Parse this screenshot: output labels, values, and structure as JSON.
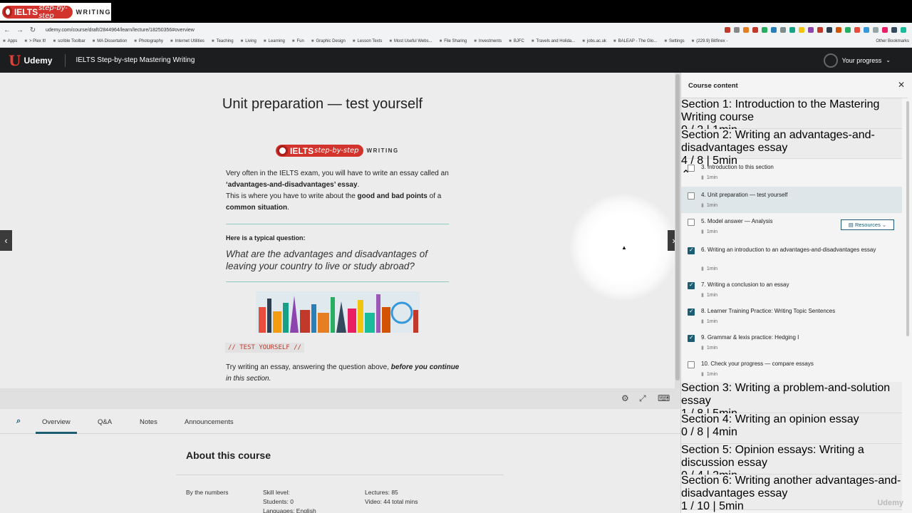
{
  "overlay_logo": {
    "brand": "IELTS",
    "stepby": "step-by-step",
    "writing": "WRITING"
  },
  "browser": {
    "back": "←",
    "forward": "→",
    "reload": "↻",
    "url": "udemy.com/course/draft/2844964/learn/lecture/18250356#overview",
    "bookmarks": [
      "Apps",
      "> Plex It!",
      "scrible Toolbar",
      "MA Dissertation",
      "Photography",
      "Internet Utilities",
      "Teaching",
      "Living",
      "Learning",
      "Fun",
      "Graphic Design",
      "Lesson Texts",
      "Most Useful Webs...",
      "File Sharing",
      "Investments",
      "BJFC",
      "Travels and Holida...",
      "jobs.ac.uk",
      "BALEAP - The Glo...",
      "Settings",
      "(229.9) Bitfinex -"
    ],
    "other_bookmarks": "Other Bookmarks",
    "ext_colors": [
      "#c0392b",
      "#888888",
      "#e67e22",
      "#c0392b",
      "#27ae60",
      "#2980b9",
      "#7f8c8d",
      "#16a085",
      "#f1c40f",
      "#8e44ad",
      "#c0392b",
      "#2c3e50",
      "#d35400",
      "#27ae60",
      "#e74c3c",
      "#3498db",
      "#95a5a6",
      "#e91e63",
      "#34495e",
      "#1abc9c"
    ]
  },
  "header": {
    "logo": "Udemy",
    "course_title": "IELTS Step-by-step Mastering Writing",
    "progress_label": "Your progress"
  },
  "slide": {
    "title": "Unit preparation — test yourself",
    "logo_brand": "IELTS",
    "logo_stepby": "step-by-step",
    "logo_writing": "WRITING",
    "para1_a": "Very often in the IELTS exam, you will have to write an essay called an ",
    "para1_b": "‘advantages-and-disadvantages’ essay",
    "para1_c": ".",
    "para1_d": "This is where you have to write about the ",
    "para1_e": "good and bad points",
    "para1_f": " of a ",
    "para1_g": "common situation",
    "para1_h": ".",
    "question_label": "Here is a typical question:",
    "question": "What are the advantages and disadvantages of leaving your country to live or study abroad?",
    "test_tag": "// TEST YOURSELF //",
    "para2_a": "Try writing an essay, answering the question above, ",
    "para2_b": "before you continue",
    "para2_c": " in this section."
  },
  "tabs": {
    "overview": "Overview",
    "qa": "Q&A",
    "notes": "Notes",
    "announcements": "Announcements"
  },
  "about": {
    "heading": "About this course",
    "by_numbers": "By the numbers",
    "skill_level": "Skill level:",
    "students": "Students: 0",
    "languages": "Languages: English",
    "lectures": "Lectures: 85",
    "video": "Video: 44 total mins"
  },
  "sidebar": {
    "title": "Course content",
    "close": "✕",
    "sections": [
      {
        "title": "Section 1: Introduction to the Mastering Writing course",
        "meta": "0 / 2 | 1min",
        "expanded": false
      },
      {
        "title": "Section 2: Writing an advantages-and-disadvantages essay",
        "meta": "4 / 8 | 5min",
        "expanded": true
      },
      {
        "title": "Section 3: Writing a problem-and-solution essay",
        "meta": "1 / 8 | 5min",
        "expanded": false
      },
      {
        "title": "Section 4: Writing an opinion essay",
        "meta": "0 / 8 | 4min",
        "expanded": false
      },
      {
        "title": "Section 5: Opinion essays: Writing a discussion essay",
        "meta": "0 / 4 | 2min",
        "expanded": false
      },
      {
        "title": "Section 6: Writing another advantages-and-disadvantages essay",
        "meta": "1 / 10 | 5min",
        "expanded": false
      }
    ],
    "items": [
      {
        "title": "3. Introduction to this section",
        "duration": "1min",
        "checked": false
      },
      {
        "title": "4. Unit preparation — test yourself",
        "duration": "1min",
        "checked": false,
        "current": true
      },
      {
        "title": "5. Model answer — Analysis",
        "duration": "1min",
        "checked": false
      },
      {
        "title": "6. Writing an introduction to an advantages-and-disadvantages essay",
        "duration": "1min",
        "checked": true
      },
      {
        "title": "7. Writing a conclusion to an essay",
        "duration": "1min",
        "checked": true
      },
      {
        "title": "8. Learner Training Practice: Writing Topic Sentences",
        "duration": "1min",
        "checked": true
      },
      {
        "title": "9. Grammar & lexis practice: Hedging I",
        "duration": "1min",
        "checked": true
      },
      {
        "title": "10. Check your progress — compare essays",
        "duration": "1min",
        "checked": false
      }
    ],
    "resources_label": "Resources"
  },
  "watermark": "Udemy",
  "colors": {
    "accent": "#1c5d73",
    "brand_red": "#d2332c",
    "header_bg": "#1c1d1f"
  }
}
